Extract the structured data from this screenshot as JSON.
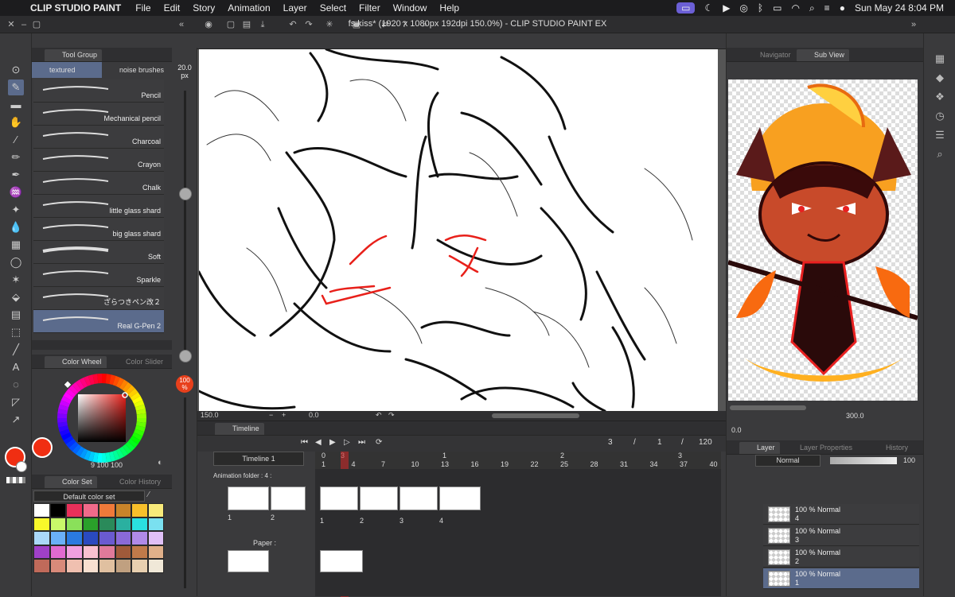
{
  "menubar": {
    "app": "CLIP STUDIO PAINT",
    "menus": [
      "File",
      "Edit",
      "Story",
      "Animation",
      "Layer",
      "Select",
      "Filter",
      "Window",
      "Help"
    ],
    "clock": "Sun May 24  8:04 PM"
  },
  "window": {
    "title": "fs kiss* (1920 x 1080px 192dpi 150.0%)  - CLIP STUDIO PAINT EX"
  },
  "subtool": {
    "tab_active": "Tool Group",
    "brush_tabs": [
      "textured brushes",
      "noise brushes"
    ],
    "brushes": [
      "Pencil",
      "Mechanical pencil",
      "Charcoal",
      "Crayon",
      "Chalk",
      "little glass shard",
      "big glass shard",
      "Soft",
      "Sparkle",
      "ざらつきペン改２",
      "Real G-Pen 2"
    ],
    "selected_brush": "Real G-Pen 2"
  },
  "brush_size": {
    "value": "20.0",
    "unit": "px",
    "opacity": "100",
    "opacity_unit": "%"
  },
  "color_wheel": {
    "tab_active": "Color Wheel",
    "tab_inactive": "Color Slider",
    "readout": "9  100  100",
    "main_color": "#f02e12"
  },
  "color_set": {
    "tab_active": "Color Set",
    "tab_inactive": "Color History",
    "set_name": "Default color set",
    "swatches": [
      "#ffffff",
      "#000000",
      "#e8305a",
      "#f06a8a",
      "#f07a3a",
      "#c8842a",
      "#f8c02a",
      "#f8ea7a",
      "#f8f82a",
      "#c8f86a",
      "#8ae05a",
      "#2aa02a",
      "#2a8a5a",
      "#2ab0a0",
      "#2ae0e0",
      "#7ae0f0",
      "#aad8f8",
      "#6ab0f8",
      "#2a7ae0",
      "#2a4ac0",
      "#6a5ad0",
      "#8a6ad8",
      "#b08ae8",
      "#e0c0f8",
      "#a040c8",
      "#e06ad0",
      "#f0a0e0",
      "#f8c0d0",
      "#e07a9a",
      "#a05a3a",
      "#c07a4a",
      "#e0b08a",
      "#c06a5a",
      "#d88a7a",
      "#f0c0b0",
      "#f8e0d0",
      "#e0c0a0",
      "#c0a080",
      "#e8d0b0",
      "#f0e8d8"
    ]
  },
  "canvas": {
    "zoom": "150.0",
    "angle": "0.0"
  },
  "right_panel": {
    "tabs": [
      "Navigator",
      "Sub View"
    ],
    "zoom": "300.0",
    "angle": "0.0",
    "layer_tabs": [
      "Layer",
      "Layer Properties",
      "History"
    ],
    "blend_mode": "Normal",
    "opacity_value": "100",
    "layers": [
      {
        "pct": "100 %",
        "mode": "Normal",
        "name": "4"
      },
      {
        "pct": "100 %",
        "mode": "Normal",
        "name": "3"
      },
      {
        "pct": "100 %",
        "mode": "Normal",
        "name": "2"
      },
      {
        "pct": "100 %",
        "mode": "Normal",
        "name": "1"
      }
    ]
  },
  "timeline": {
    "tab": "Timeline",
    "name": "Timeline 1",
    "current_frame": "3",
    "sep1": "/",
    "start": "1",
    "sep2": "/",
    "end": "120",
    "folder_label": "Animation folder : 4 :",
    "paper_label": "Paper :",
    "cel_numbers": [
      "1",
      "2",
      "3",
      "4"
    ],
    "thumb_labels": [
      "1",
      "2"
    ],
    "ruler_numbers": [
      "1",
      "4",
      "7",
      "10",
      "13",
      "16",
      "19",
      "22",
      "25",
      "28",
      "31",
      "34",
      "37",
      "40"
    ],
    "ruler_marks": [
      "0",
      "3",
      "1",
      "2",
      "3"
    ]
  }
}
